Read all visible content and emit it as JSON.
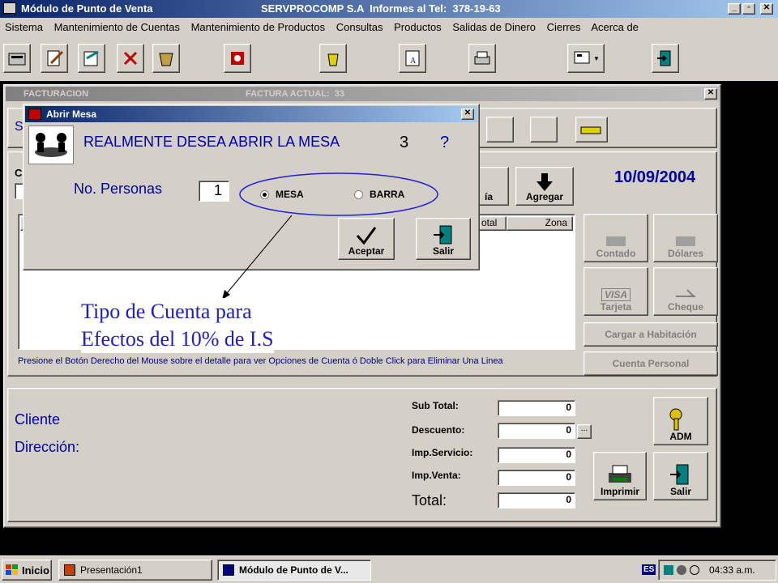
{
  "app": {
    "title": "Módulo de Punto de Venta",
    "company": "SERVPROCOMP S.A  Informes al Tel:  378-19-63"
  },
  "menu": [
    "Sistema",
    "Mantenimiento de Cuentas",
    "Mantenimiento de Productos",
    "Consultas",
    "Productos",
    "Salidas de Dinero",
    "Cierres",
    "Acerca de"
  ],
  "toolbar_icons": [
    "register-icon",
    "edit-icon",
    "write-icon",
    "delete-icon",
    "basket-icon",
    "menu-icon",
    "trash-icon",
    "book-icon",
    "printer-icon",
    "display-icon",
    "exit-icon"
  ],
  "facturacion": {
    "title": "FACTURACION",
    "factura_label": "FACTURA ACTUAL:  33",
    "date": "10/09/2004",
    "agregar_label": "Agregar",
    "partial_btn_label": "ía",
    "partial_s": "S",
    "partial_c": "C",
    "partial_i": "I",
    "columns": [
      "otal",
      "Zona"
    ],
    "status_hint": "Presione el Botón Derecho del Mouse sobre el detalle para ver Opciones de Cuenta ó Doble Click para Eliminar Una Linea",
    "pay": {
      "contado": "Contado",
      "dolares": "Dólares",
      "tarjeta": "Tarjeta",
      "visa": "VISA",
      "cheque": "Cheque",
      "cargar": "Cargar a Habitación",
      "cuenta": "Cuenta Personal"
    },
    "cliente_label": "Cliente",
    "direccion_label": "Dirección:",
    "totals": {
      "subtotal_label": "Sub Total:",
      "subtotal": "0",
      "descuento_label": "Descuento:",
      "descuento": "0",
      "servicio_label": "Imp.Servicio:",
      "servicio": "0",
      "venta_label": "Imp.Venta:",
      "venta": "0",
      "total_label": "Total:",
      "total": "0",
      "desc_btn": "..."
    },
    "adm_label": "ADM",
    "imprimir_label": "Imprimir",
    "salir_label": "Salir"
  },
  "dialog": {
    "title": "Abrir Mesa",
    "question": "REALMENTE DESEA ABRIR LA MESA",
    "mesa_num": "3",
    "qmark": "?",
    "personas_label": "No. Personas",
    "personas_value": "1",
    "radio_mesa": "MESA",
    "radio_barra": "BARRA",
    "aceptar": "Aceptar",
    "salir": "Salir"
  },
  "annotation": {
    "line1": "Tipo de Cuenta para",
    "line2": "Efectos del 10% de I.S"
  },
  "taskbar": {
    "start": "Inicio",
    "task1": "Presentación1",
    "task2": "Módulo de Punto de V...",
    "lang": "ES",
    "clock": "04:33 a.m."
  }
}
